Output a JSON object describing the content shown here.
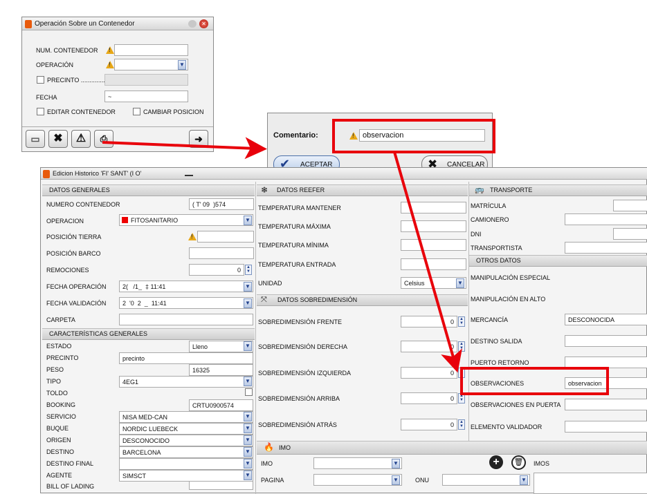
{
  "dialog1": {
    "title": "Operación Sobre un Contenedor",
    "num_contenedor_label": "NUM. CONTENEDOR",
    "num_contenedor_value": "",
    "operacion_label": "OPERACIÓN",
    "operacion_value": "",
    "precinto_label": "PRECINTO ...............",
    "fecha_label": "FECHA",
    "fecha_value": "~",
    "editar_label": "EDITAR CONTENEDOR",
    "cambiar_label": "CAMBIAR POSICION"
  },
  "comment": {
    "label": "Comentario:",
    "value": "observacion",
    "accept": "ACEPTAR",
    "cancel": "CANCELAR"
  },
  "edit": {
    "title": "Edicion Historico 'FI' SANT' (I O'",
    "generales": {
      "header": "DATOS GENERALES",
      "numero_label": "NUMERO CONTENEDOR",
      "numero_value": "( T' 09  )574",
      "operacion_label": "OPERACION",
      "operacion_value": "FITOSANITARIO",
      "pos_tierra_label": "POSICIÓN TIERRA",
      "pos_barco_label": "POSICIÓN BARCO",
      "remociones_label": "REMOCIONES",
      "remociones_value": "0",
      "fecha_op_label": "FECHA OPERACIÓN",
      "fecha_op_value": "2(   /1_  ‡ 11:41",
      "fecha_val_label": "FECHA VALIDACIÓN",
      "fecha_val_value": "2  '0  2  _  11:41",
      "carpeta_label": "CARPETA"
    },
    "caracteristicas": {
      "header": "CARACTERÍSTICAS GENERALES",
      "estado_label": "ESTADO",
      "estado_value": "Lleno",
      "precinto_label": "PRECINTO",
      "precinto_value": "precinto",
      "peso_label": "PESO",
      "peso_value": "16325",
      "tipo_label": "TIPO",
      "tipo_value": "4EG1",
      "toldo_label": "TOLDO",
      "booking_label": "BOOKING",
      "booking_value": "CRTU0900574",
      "servicio_label": "SERVICIO",
      "servicio_value": "NISA MED-CAN",
      "buque_label": "BUQUE",
      "buque_value": "NORDIC LUEBECK",
      "origen_label": "ORIGEN",
      "origen_value": "DESCONOCIDO",
      "destino_label": "DESTINO",
      "destino_value": "BARCELONA",
      "destino_final_label": "DESTINO FINAL",
      "agente_label": "AGENTE",
      "agente_value": "SIMSCT",
      "bill_label": "BILL OF LADING"
    },
    "reefer": {
      "header": "DATOS REEFER",
      "temp_mantener": "TEMPERATURA MANTENER",
      "temp_maxima": "TEMPERATURA MÁXIMA",
      "temp_minima": "TEMPERATURA MÍNIMA",
      "temp_entrada": "TEMPERATURA ENTRADA",
      "unidad_label": "UNIDAD",
      "unidad_value": "Celsius"
    },
    "sobredim": {
      "header": "DATOS SOBREDIMENSIÓN",
      "frente": "SOBREDIMENSIÓN FRENTE",
      "derecha": "SOBREDIMENSIÓN DERECHA",
      "izquierda": "SOBREDIMENSIÓN IZQUIERDA",
      "arriba": "SOBREDIMENSIÓN ARRIBA",
      "atras": "SOBREDIMENSIÓN ATRÁS",
      "zero": "0"
    },
    "transporte": {
      "header": "TRANSPORTE",
      "matricula": "MATRÍCULA",
      "camionero": "CAMIONERO",
      "dni": "DNI",
      "transportista": "TRANSPORTISTA"
    },
    "otros": {
      "header": "OTROS DATOS",
      "manip_especial": "MANIPULACIÓN ESPECIAL",
      "manip_alto": "MANIPULACIÓN EN ALTO",
      "mercancia_label": "MERCANCÍA",
      "mercancia_value": "DESCONOCIDA",
      "destino_salida": "DESTINO SALIDA",
      "puerto_retorno": "PUERTO RETORNO",
      "observaciones_label": "OBSERVACIONES",
      "observaciones_value": "observacion",
      "obs_puerta": "OBSERVACIONES EN PUERTA",
      "elemento": "ELEMENTO VALIDADOR"
    },
    "imo": {
      "header": "IMO",
      "imo_label": "IMO",
      "imos_label": "IMOS",
      "pagina_label": "PAGINA",
      "onu_label": "ONU"
    }
  },
  "colors": {
    "highlight": "#e8000b",
    "warning": "#e8a817",
    "app_icon": "#e85a0c"
  }
}
